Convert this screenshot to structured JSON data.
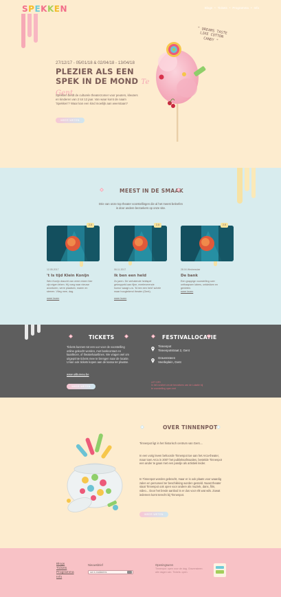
{
  "brand": {
    "logo_text": "SPEKKEN",
    "logo_colors": [
      "#f26f8a",
      "#f3bd2a",
      "#6fcbd7",
      "#f26f8a",
      "#a3cf5b",
      "#f3bd2a",
      "#f26f8a"
    ]
  },
  "nav": {
    "items": [
      "Blogs",
      "Tickets",
      "Programma",
      "Info"
    ],
    "separator": "•"
  },
  "hero": {
    "dates": "27/12/17 - 05/01/18 & 02/04/18 - 13/04/18",
    "title": "PLEZIER ALS EEN SPEK IN DE MOND",
    "title_script": "Te Gent",
    "text": "Spekken biedt de culturele theaterzomer voor peuters, kleuters en kinderen van 2 tot 12 jaar. Van waar komt de naam 'Spekken'? Waar kan een kind moeilijk aan weerstaan?",
    "button": "MEER WETEN",
    "quote": "\" DREAMS TASTE LIKE COTTON CANDY \""
  },
  "smaak": {
    "title": "MEEST IN DE SMAAK",
    "intro": "Drie van onze top theater voorstellingen die al het meest beleefen is door andere bezoekers op onze site.",
    "cards": [
      {
        "badge": "2-5",
        "date": "12.05.2017",
        "title": "'t Is tijd Klein Konijn",
        "text": "Wen Konijn draccht van verre reizen hier zijn eigen leben. Hij voeg naar nieuwe avonturen, verre plaatsen, maren en sterren. Vlieg mee, dag.",
        "link": "meer lezen"
      },
      {
        "badge": "2-5",
        "date": "06.11.2017",
        "title": "Ik ben een held",
        "text": "Zo jaren. De verhalende heldspel gekroppeld aan fijne, meeleverende humor waagt u.w. 'Ik ben een held' schele maar hoogtekend theater (Gent).",
        "link": "meer lezen"
      },
      {
        "badge": "2-5",
        "date": "28.04 Wednesdae",
        "title": "De bank",
        "text": "Een grappige voorstelling over onthaapsen lalees, ontdekken en genieten.",
        "link": "meer lezen"
      }
    ]
  },
  "tickets": {
    "title": "TICKETS",
    "text": "Tickets kunnen tot een uur voor de voorstelling online gekocht worden, met bankcontact en kaartlezer, of theaterkaartlines. We vragen wel om uitgeprinte tickets mee te brengen naar de locatie. U kan ook tickets kopen aan de kassa ter plaatse.",
    "link": "www.uitbureau.be",
    "button": "MEER WETEN"
  },
  "festival": {
    "title": "FESTIVALLOCATIE",
    "locations": [
      {
        "name": "Tinnenpot",
        "address": "Tinnenpotstraat 2, Gent"
      },
      {
        "name": "Gravensteen",
        "address": "Veerleplein, Gent"
      }
    ],
    "notice_title": "LET OP!!",
    "notice_text": "In het rondhet om de bezoekers van de Lokatie bij te voorstelling open met"
  },
  "over": {
    "title": "OVER TINNENPOT",
    "p1": "Tinnenpot ligt in het historisch centrum van Gent....",
    "p2": "In een vorig leven behoorde Tinnenpot toe aan het Arca-theater, maar toen Arca in 2007 het publieksafmaaites, bestelde Tinnenpot een ander te gaan met een pandje als artistiek leider.",
    "p3": "In Tinnenpot worden gebracht, maar er is ook plaats voor waardig zalen en personeel ter beschikking worden gesteld. Naast theater staat Tinnenpot ook open voor andere als muziek, dans, film, video... Door het brede aanbod is er dus voor elk wat wils. Zowat iedereen komt terecht bij Tinnenpot.",
    "button": "MEER WETEN"
  },
  "footer": {
    "links": [
      "Blogs",
      "Tickets",
      "Programma",
      "Info"
    ],
    "newsletter_label": "Nieuwsbrief",
    "newsletter_placeholder": "uw e-mailadres",
    "hours_label": "Openingsuren",
    "hours_text": "Tinnenpot: open voor de dag. Gravensteen: alle dagen van. Tickets: open."
  },
  "colors": {
    "hero_bg": "#fdeccf",
    "smaak_bg": "#d8ecee",
    "dark_bg": "#5e5e5e",
    "footer_bg": "#f8c2c6",
    "accent_pink": "#f6a9b6",
    "accent_blue": "#cfe7f0"
  }
}
